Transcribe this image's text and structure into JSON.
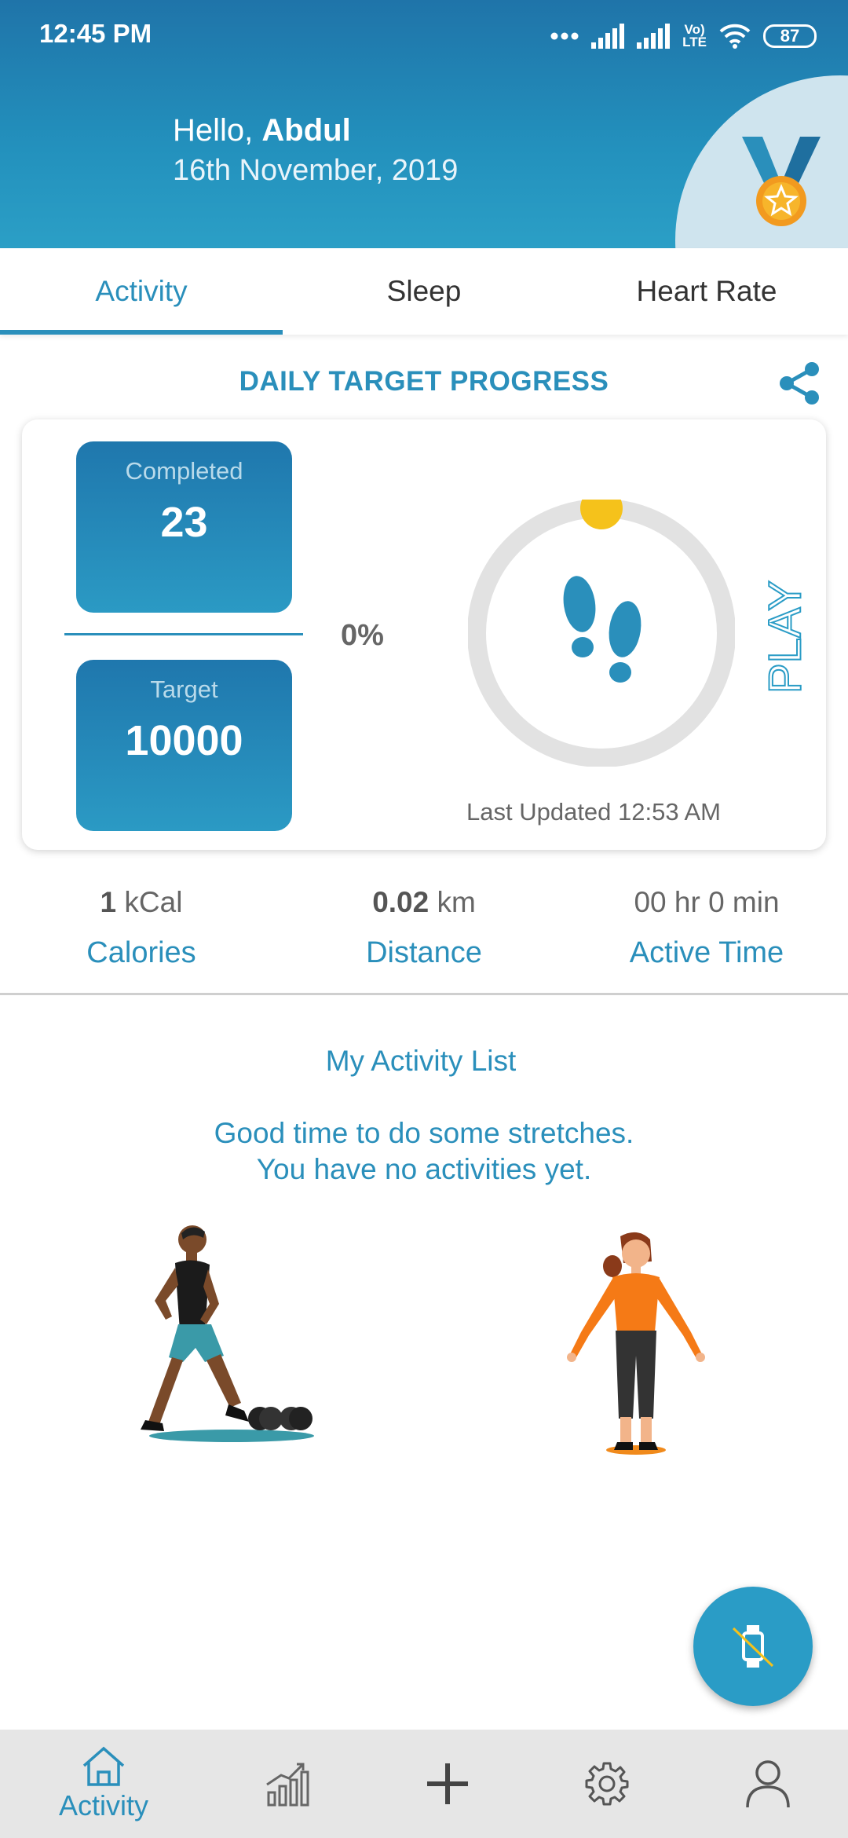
{
  "status_bar": {
    "time": "12:45 PM",
    "battery": "87",
    "network_label_top": "Vo)",
    "network_label_bottom": "LTE"
  },
  "header": {
    "greeting": "Hello,",
    "user_name": "Abdul",
    "date": "16th November, 2019"
  },
  "tabs": [
    {
      "label": "Activity",
      "active": true
    },
    {
      "label": "Sleep",
      "active": false
    },
    {
      "label": "Heart Rate",
      "active": false
    }
  ],
  "daily_target": {
    "title": "DAILY TARGET PROGRESS",
    "completed_label": "Completed",
    "completed_value": "23",
    "target_label": "Target",
    "target_value": "10000",
    "percent": "0%",
    "progress_fraction": 0.0,
    "play_label": "PLAY",
    "last_updated": "Last Updated 12:53 AM"
  },
  "metrics": [
    {
      "value": "1",
      "unit": "kCal",
      "caption": "Calories"
    },
    {
      "value": "0.02",
      "unit": "km",
      "caption": "Distance"
    },
    {
      "value": "",
      "unit": "00 hr 0 min",
      "caption": "Active Time"
    }
  ],
  "activity_list": {
    "title": "My Activity List",
    "empty_line1": "Good time to do some stretches.",
    "empty_line2": "You have no activities yet."
  },
  "bottom_nav": {
    "activity_label": "Activity"
  },
  "colors": {
    "accent": "#2a8fbb",
    "header_top": "#1f74a9",
    "progress_dot": "#f5c21b",
    "nav_bg": "#e6e6e6"
  }
}
